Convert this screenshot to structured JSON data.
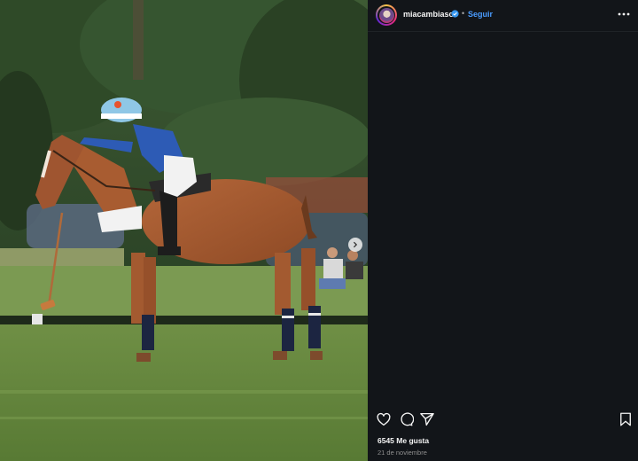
{
  "post": {
    "username": "miacambiaso",
    "verified": true,
    "separator": "•",
    "follow_label": "Seguir",
    "likes_text": "6545 Me gusta",
    "date_text": "21 de noviembre"
  },
  "icons": {
    "more": "more-horizontal-icon",
    "like": "heart-icon",
    "comment": "comment-icon",
    "share": "send-icon",
    "save": "bookmark-icon",
    "next": "chevron-right-icon",
    "verified": "verified-badge-icon"
  },
  "colors": {
    "panel_bg": "#121519",
    "text": "#f5f5f5",
    "link": "#4a9cff",
    "muted": "#8e8e8e",
    "verified": "#3797f0"
  }
}
